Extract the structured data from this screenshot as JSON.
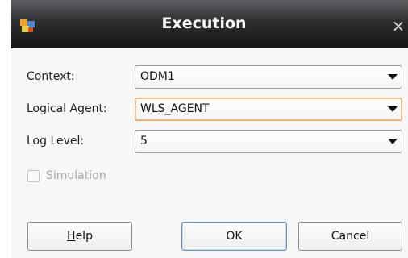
{
  "window": {
    "title": "Execution",
    "close_glyph": "×",
    "app_icon": "odi-app-icon"
  },
  "form": {
    "context": {
      "label": "Context:",
      "value": "ODM1"
    },
    "logical_agent": {
      "label": "Logical Agent:",
      "value": "WLS_AGENT"
    },
    "log_level": {
      "label": "Log Level:",
      "value": "5"
    },
    "simulation": {
      "label": "Simulation",
      "checked": false,
      "enabled": false
    }
  },
  "buttons": {
    "help": {
      "mnemonic": "H",
      "rest": "elp"
    },
    "ok": "OK",
    "cancel": "Cancel"
  },
  "colors": {
    "title_bar": "#2d2e30",
    "focus_border": "#e6a45a",
    "default_button_border": "#6e8fbf",
    "disabled_text": "#a8a8a8"
  }
}
